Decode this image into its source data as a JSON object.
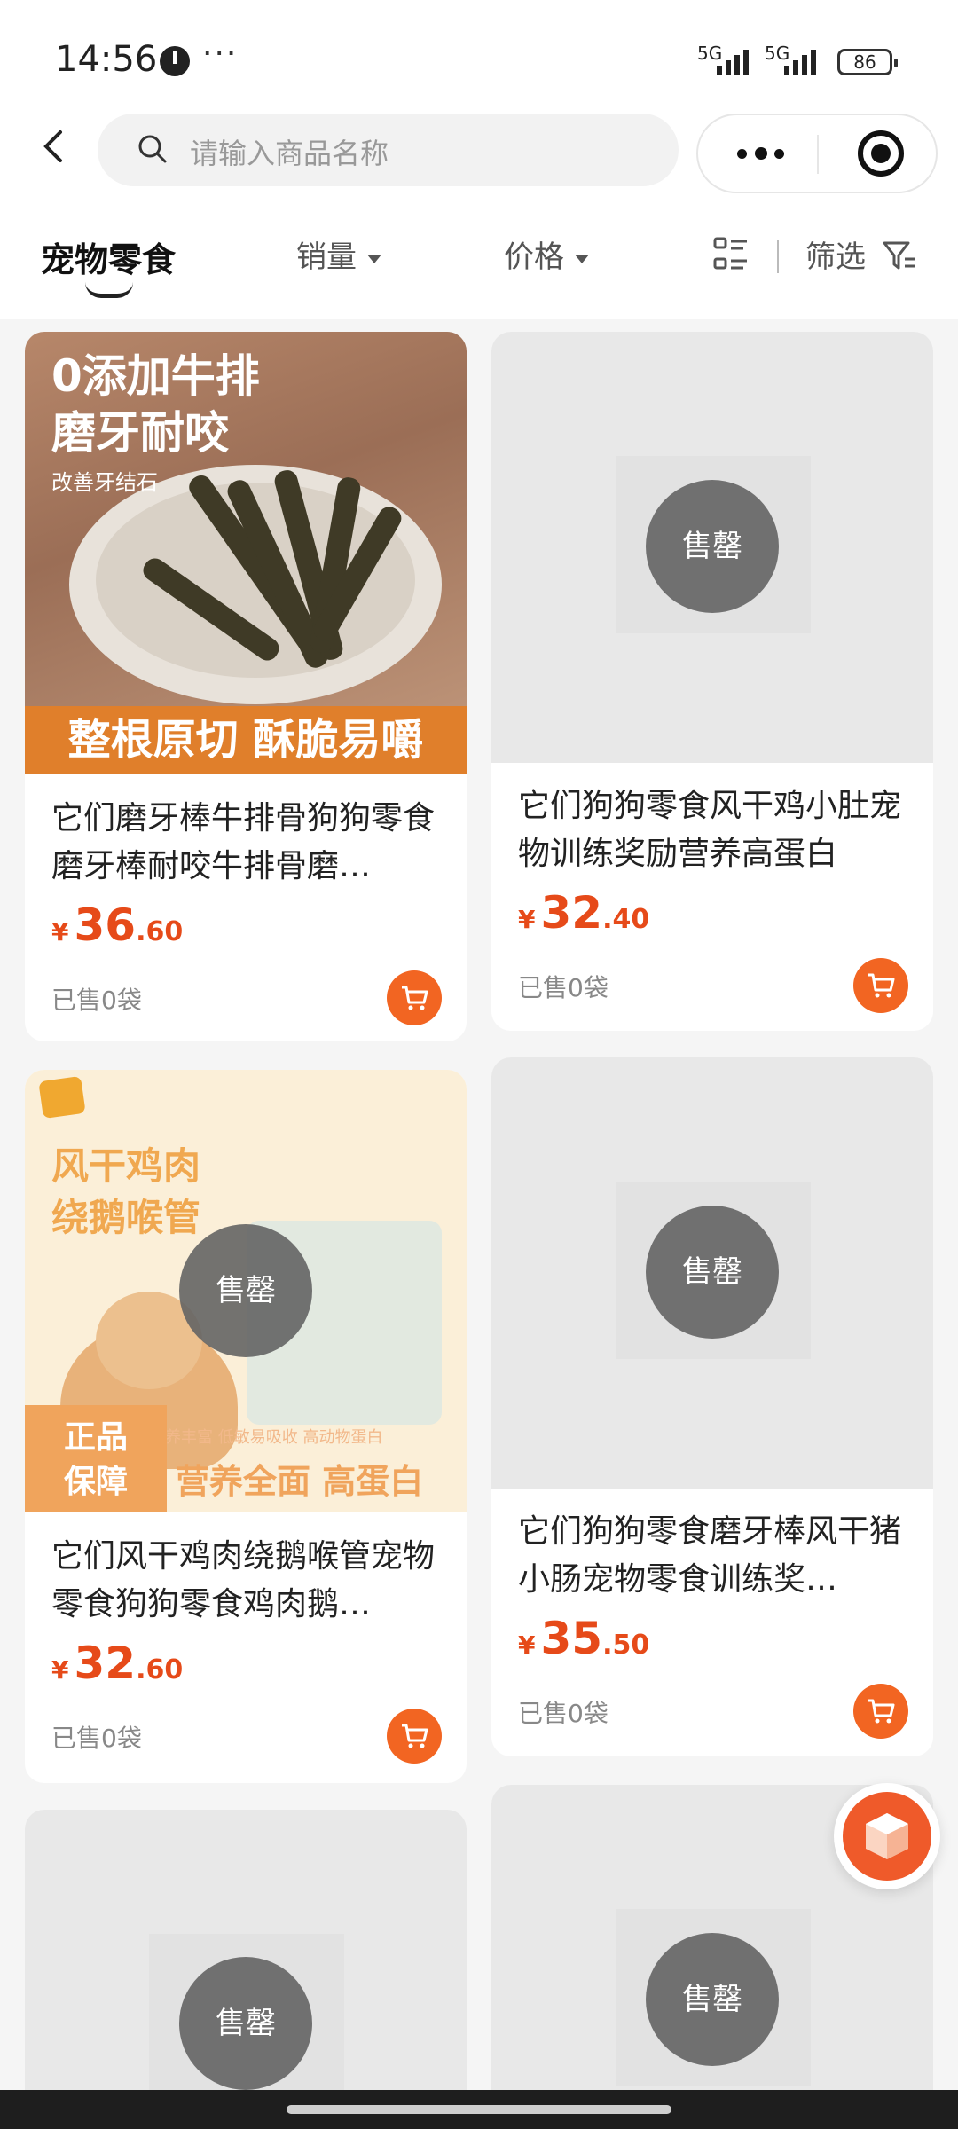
{
  "status_bar": {
    "time": "14:56",
    "more": "···",
    "signal1": "5G",
    "signal2": "5G",
    "battery": "86"
  },
  "header": {
    "search_placeholder": "请输入商品名称"
  },
  "filters": {
    "category": "宠物零食",
    "sales": "销量",
    "price": "价格",
    "filter": "筛选"
  },
  "colors": {
    "accent": "#e64a19",
    "cart_button": "#f26522"
  },
  "products": [
    {
      "title": "它们磨牙棒牛排骨狗狗零食磨牙棒耐咬牛排骨磨…",
      "currency": "¥",
      "price_int": "36",
      "price_dec": ".60",
      "sold": "已售0袋",
      "image_title": "0添加牛排\n磨牙耐咬",
      "image_sub": "改善牙结石",
      "image_band": "整根原切 酥脆易嚼",
      "sold_out": false
    },
    {
      "title": "它们狗狗零食风干鸡小肚宠物训练奖励营养高蛋白",
      "currency": "¥",
      "price_int": "32",
      "price_dec": ".40",
      "sold": "已售0袋",
      "sold_out_label": "售罄",
      "sold_out": true
    },
    {
      "title": "它们风干鸡肉绕鹅喉管宠物零食狗狗零食鸡肉鹅…",
      "currency": "¥",
      "price_int": "32",
      "price_dec": ".60",
      "sold": "已售0袋",
      "sold_out_label": "售罄",
      "image_title": "风干鸡肉\n绕鹅喉管",
      "image_tag": "正品\n保障",
      "image_slogan": "营养全面 高蛋白",
      "image_sub": "营养丰富 低敏易吸收 高动物蛋白",
      "sold_out": true
    },
    {
      "title": "它们狗狗零食磨牙棒风干猪小肠宠物零食训练奖…",
      "currency": "¥",
      "price_int": "35",
      "price_dec": ".50",
      "sold": "已售0袋",
      "sold_out_label": "售罄",
      "sold_out": true
    },
    {
      "sold_out_label": "售罄",
      "sold_out": true
    },
    {
      "sold_out_label": "售罄",
      "sold_out": true
    }
  ]
}
